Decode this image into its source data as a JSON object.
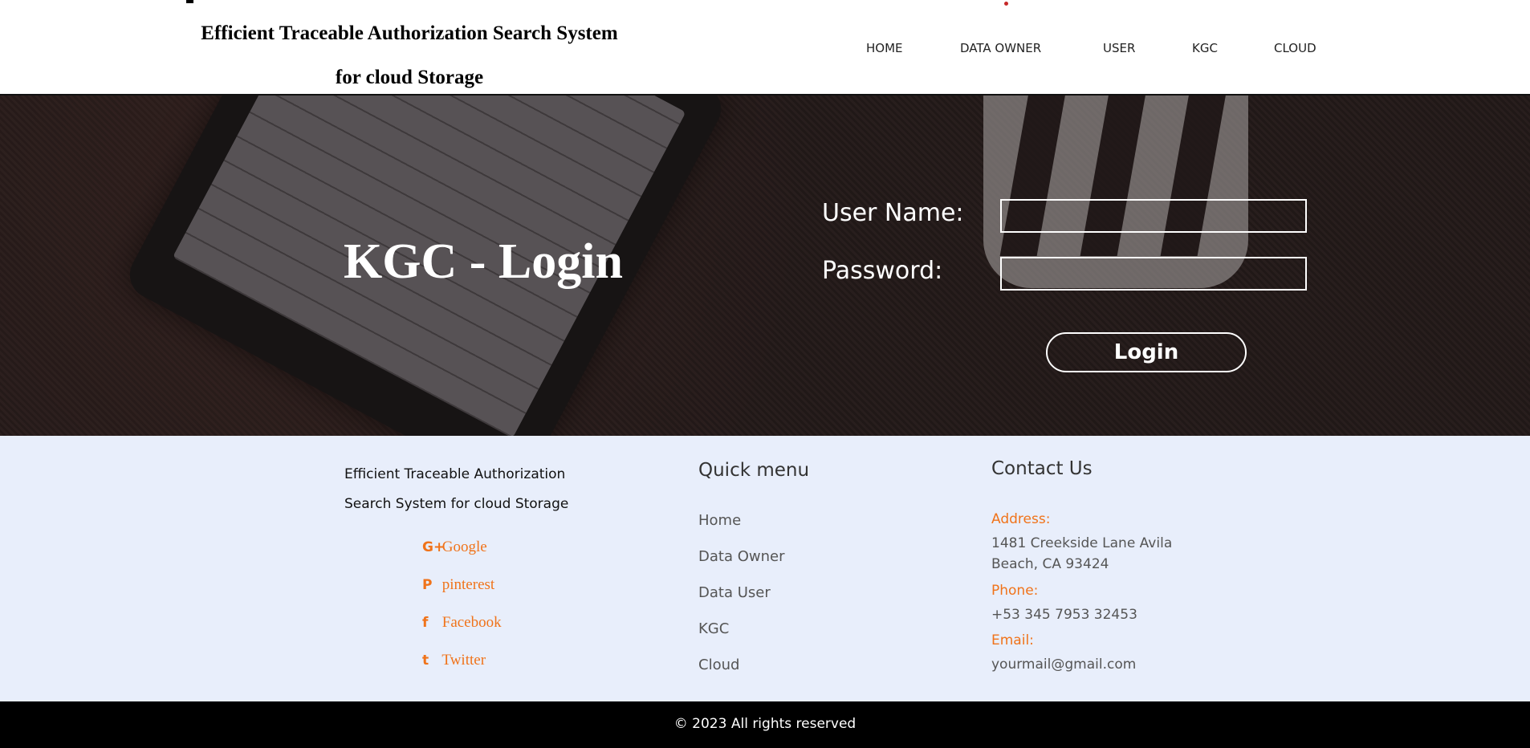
{
  "header": {
    "title_line1": "Efficient Traceable Authorization Search System",
    "title_line2": "for cloud Storage",
    "nav": [
      "HOME",
      "DATA OWNER",
      "USER",
      "KGC",
      "CLOUD"
    ]
  },
  "hero": {
    "title": "KGC - Login",
    "username_label": "User Name:",
    "password_label": "Password:",
    "username_value": "",
    "password_value": "",
    "login_label": "Login"
  },
  "footer": {
    "about_line1": "Efficient Traceable Authorization",
    "about_line2": "Search System for cloud Storage",
    "social": [
      {
        "icon": "google-plus-icon",
        "glyph": "G+",
        "label": "Google"
      },
      {
        "icon": "pinterest-icon",
        "glyph": "P",
        "label": "pinterest"
      },
      {
        "icon": "facebook-icon",
        "glyph": "f",
        "label": "Facebook"
      },
      {
        "icon": "twitter-icon",
        "glyph": "t",
        "label": "Twitter"
      }
    ],
    "quick_menu_title": "Quick menu",
    "quick_menu": [
      "Home",
      "Data Owner",
      "Data User",
      "KGC",
      "Cloud"
    ],
    "contact_title": "Contact Us",
    "address_label": "Address:",
    "address": "1481 Creekside Lane Avila Beach, CA 93424",
    "phone_label": "Phone:",
    "phone": "+53 345 7953 32453",
    "email_label": "Email:",
    "email": "yourmail@gmail.com",
    "accent_color": "#f0731a"
  },
  "copyright": "© 2023 All rights reserved"
}
